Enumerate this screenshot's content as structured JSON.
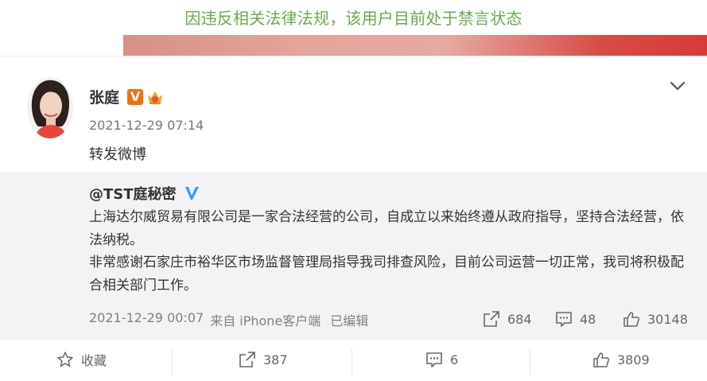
{
  "ban_notice": "因违反相关法律法规，该用户目前处于禁言状态",
  "post": {
    "author": "张庭",
    "verified_badge": "V",
    "timestamp": "2021-12-29 07:14",
    "text": "转发微博",
    "menu_icon": "chevron-down-icon"
  },
  "repost": {
    "author": "@TST庭秘密",
    "paragraphs": [
      "上海达尔威贸易有限公司是一家合法经营的公司，自成立以来始终遵从政府指导，坚持合法经营，依法纳税。",
      "非常感谢石家庄市裕华区市场监督管理局指导我司排查风险，目前公司运营一切正常，我司将积极配合相关部门工作。"
    ],
    "time": "2021-12-29 00:07",
    "source": "来自 iPhone客户端",
    "edited": "已编辑",
    "shares": "684",
    "comments": "48",
    "likes": "30148"
  },
  "bottom_bar": {
    "favorite": "收藏",
    "shares": "387",
    "comments": "6",
    "likes": "3809"
  },
  "colors": {
    "ban_text": "#6aa84f",
    "repost_bg": "#f3f3f5",
    "badge_orange": "#f36f10",
    "badge_blue": "#2f9cf2"
  }
}
